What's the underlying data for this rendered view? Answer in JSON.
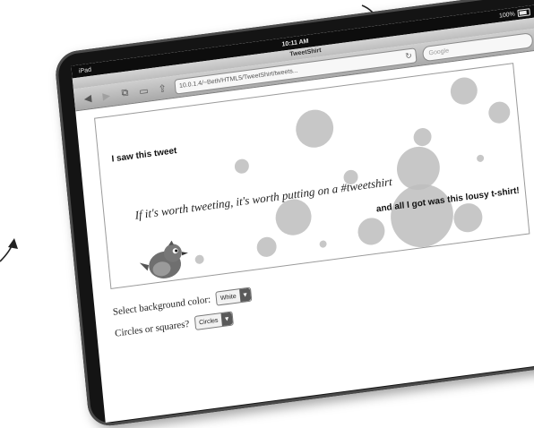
{
  "statusbar": {
    "device": "iPad",
    "time": "10:11 AM",
    "battery": "100%"
  },
  "browser": {
    "title": "TweetShirt",
    "url": "10.0.1.4/~Beth/HTML5/TweetShirt/tweets...",
    "search_placeholder": "Google"
  },
  "tweetshirt": {
    "line1": "I saw this tweet",
    "quote": "If it's worth tweeting, it's worth putting on a #tweetshirt",
    "line3": "and all I got was this lousy t-shirt!"
  },
  "controls": {
    "background_label": "Select background color:",
    "background_value": "White",
    "shape_label": "Circles or squares?",
    "shape_value": "Circles"
  },
  "colors": {
    "canvas_bg": "#ffffff",
    "shape": "#bdbdbd",
    "device": "#141414"
  }
}
